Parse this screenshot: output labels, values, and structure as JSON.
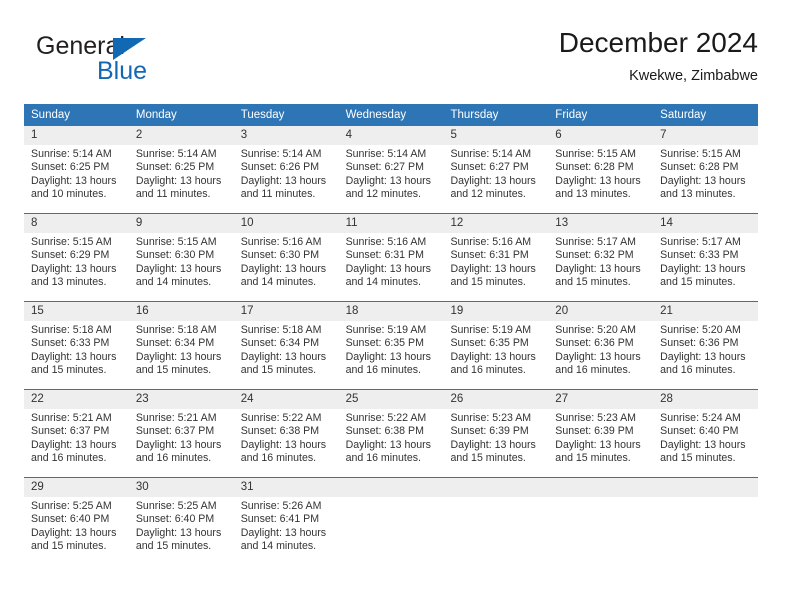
{
  "brand": {
    "name_part1": "General",
    "name_part2": "Blue",
    "logo_icon": "triangle-flag-icon",
    "color_primary": "#1268b3",
    "color_text": "#231f20"
  },
  "header": {
    "title": "December 2024",
    "subtitle": "Kwekwe, Zimbabwe"
  },
  "calendar": {
    "header_bg": "#2e75b6",
    "header_text_color": "#ffffff",
    "day_band_bg": "#eeeeee",
    "weekdays": [
      "Sunday",
      "Monday",
      "Tuesday",
      "Wednesday",
      "Thursday",
      "Friday",
      "Saturday"
    ],
    "weeks": [
      [
        {
          "day": "1",
          "sunrise": "Sunrise: 5:14 AM",
          "sunset": "Sunset: 6:25 PM",
          "daylight_line1": "Daylight: 13 hours",
          "daylight_line2": "and 10 minutes."
        },
        {
          "day": "2",
          "sunrise": "Sunrise: 5:14 AM",
          "sunset": "Sunset: 6:25 PM",
          "daylight_line1": "Daylight: 13 hours",
          "daylight_line2": "and 11 minutes."
        },
        {
          "day": "3",
          "sunrise": "Sunrise: 5:14 AM",
          "sunset": "Sunset: 6:26 PM",
          "daylight_line1": "Daylight: 13 hours",
          "daylight_line2": "and 11 minutes."
        },
        {
          "day": "4",
          "sunrise": "Sunrise: 5:14 AM",
          "sunset": "Sunset: 6:27 PM",
          "daylight_line1": "Daylight: 13 hours",
          "daylight_line2": "and 12 minutes."
        },
        {
          "day": "5",
          "sunrise": "Sunrise: 5:14 AM",
          "sunset": "Sunset: 6:27 PM",
          "daylight_line1": "Daylight: 13 hours",
          "daylight_line2": "and 12 minutes."
        },
        {
          "day": "6",
          "sunrise": "Sunrise: 5:15 AM",
          "sunset": "Sunset: 6:28 PM",
          "daylight_line1": "Daylight: 13 hours",
          "daylight_line2": "and 13 minutes."
        },
        {
          "day": "7",
          "sunrise": "Sunrise: 5:15 AM",
          "sunset": "Sunset: 6:28 PM",
          "daylight_line1": "Daylight: 13 hours",
          "daylight_line2": "and 13 minutes."
        }
      ],
      [
        {
          "day": "8",
          "sunrise": "Sunrise: 5:15 AM",
          "sunset": "Sunset: 6:29 PM",
          "daylight_line1": "Daylight: 13 hours",
          "daylight_line2": "and 13 minutes."
        },
        {
          "day": "9",
          "sunrise": "Sunrise: 5:15 AM",
          "sunset": "Sunset: 6:30 PM",
          "daylight_line1": "Daylight: 13 hours",
          "daylight_line2": "and 14 minutes."
        },
        {
          "day": "10",
          "sunrise": "Sunrise: 5:16 AM",
          "sunset": "Sunset: 6:30 PM",
          "daylight_line1": "Daylight: 13 hours",
          "daylight_line2": "and 14 minutes."
        },
        {
          "day": "11",
          "sunrise": "Sunrise: 5:16 AM",
          "sunset": "Sunset: 6:31 PM",
          "daylight_line1": "Daylight: 13 hours",
          "daylight_line2": "and 14 minutes."
        },
        {
          "day": "12",
          "sunrise": "Sunrise: 5:16 AM",
          "sunset": "Sunset: 6:31 PM",
          "daylight_line1": "Daylight: 13 hours",
          "daylight_line2": "and 15 minutes."
        },
        {
          "day": "13",
          "sunrise": "Sunrise: 5:17 AM",
          "sunset": "Sunset: 6:32 PM",
          "daylight_line1": "Daylight: 13 hours",
          "daylight_line2": "and 15 minutes."
        },
        {
          "day": "14",
          "sunrise": "Sunrise: 5:17 AM",
          "sunset": "Sunset: 6:33 PM",
          "daylight_line1": "Daylight: 13 hours",
          "daylight_line2": "and 15 minutes."
        }
      ],
      [
        {
          "day": "15",
          "sunrise": "Sunrise: 5:18 AM",
          "sunset": "Sunset: 6:33 PM",
          "daylight_line1": "Daylight: 13 hours",
          "daylight_line2": "and 15 minutes."
        },
        {
          "day": "16",
          "sunrise": "Sunrise: 5:18 AM",
          "sunset": "Sunset: 6:34 PM",
          "daylight_line1": "Daylight: 13 hours",
          "daylight_line2": "and 15 minutes."
        },
        {
          "day": "17",
          "sunrise": "Sunrise: 5:18 AM",
          "sunset": "Sunset: 6:34 PM",
          "daylight_line1": "Daylight: 13 hours",
          "daylight_line2": "and 15 minutes."
        },
        {
          "day": "18",
          "sunrise": "Sunrise: 5:19 AM",
          "sunset": "Sunset: 6:35 PM",
          "daylight_line1": "Daylight: 13 hours",
          "daylight_line2": "and 16 minutes."
        },
        {
          "day": "19",
          "sunrise": "Sunrise: 5:19 AM",
          "sunset": "Sunset: 6:35 PM",
          "daylight_line1": "Daylight: 13 hours",
          "daylight_line2": "and 16 minutes."
        },
        {
          "day": "20",
          "sunrise": "Sunrise: 5:20 AM",
          "sunset": "Sunset: 6:36 PM",
          "daylight_line1": "Daylight: 13 hours",
          "daylight_line2": "and 16 minutes."
        },
        {
          "day": "21",
          "sunrise": "Sunrise: 5:20 AM",
          "sunset": "Sunset: 6:36 PM",
          "daylight_line1": "Daylight: 13 hours",
          "daylight_line2": "and 16 minutes."
        }
      ],
      [
        {
          "day": "22",
          "sunrise": "Sunrise: 5:21 AM",
          "sunset": "Sunset: 6:37 PM",
          "daylight_line1": "Daylight: 13 hours",
          "daylight_line2": "and 16 minutes."
        },
        {
          "day": "23",
          "sunrise": "Sunrise: 5:21 AM",
          "sunset": "Sunset: 6:37 PM",
          "daylight_line1": "Daylight: 13 hours",
          "daylight_line2": "and 16 minutes."
        },
        {
          "day": "24",
          "sunrise": "Sunrise: 5:22 AM",
          "sunset": "Sunset: 6:38 PM",
          "daylight_line1": "Daylight: 13 hours",
          "daylight_line2": "and 16 minutes."
        },
        {
          "day": "25",
          "sunrise": "Sunrise: 5:22 AM",
          "sunset": "Sunset: 6:38 PM",
          "daylight_line1": "Daylight: 13 hours",
          "daylight_line2": "and 16 minutes."
        },
        {
          "day": "26",
          "sunrise": "Sunrise: 5:23 AM",
          "sunset": "Sunset: 6:39 PM",
          "daylight_line1": "Daylight: 13 hours",
          "daylight_line2": "and 15 minutes."
        },
        {
          "day": "27",
          "sunrise": "Sunrise: 5:23 AM",
          "sunset": "Sunset: 6:39 PM",
          "daylight_line1": "Daylight: 13 hours",
          "daylight_line2": "and 15 minutes."
        },
        {
          "day": "28",
          "sunrise": "Sunrise: 5:24 AM",
          "sunset": "Sunset: 6:40 PM",
          "daylight_line1": "Daylight: 13 hours",
          "daylight_line2": "and 15 minutes."
        }
      ],
      [
        {
          "day": "29",
          "sunrise": "Sunrise: 5:25 AM",
          "sunset": "Sunset: 6:40 PM",
          "daylight_line1": "Daylight: 13 hours",
          "daylight_line2": "and 15 minutes."
        },
        {
          "day": "30",
          "sunrise": "Sunrise: 5:25 AM",
          "sunset": "Sunset: 6:40 PM",
          "daylight_line1": "Daylight: 13 hours",
          "daylight_line2": "and 15 minutes."
        },
        {
          "day": "31",
          "sunrise": "Sunrise: 5:26 AM",
          "sunset": "Sunset: 6:41 PM",
          "daylight_line1": "Daylight: 13 hours",
          "daylight_line2": "and 14 minutes."
        },
        {
          "day": "",
          "sunrise": "",
          "sunset": "",
          "daylight_line1": "",
          "daylight_line2": ""
        },
        {
          "day": "",
          "sunrise": "",
          "sunset": "",
          "daylight_line1": "",
          "daylight_line2": ""
        },
        {
          "day": "",
          "sunrise": "",
          "sunset": "",
          "daylight_line1": "",
          "daylight_line2": ""
        },
        {
          "day": "",
          "sunrise": "",
          "sunset": "",
          "daylight_line1": "",
          "daylight_line2": ""
        }
      ]
    ]
  }
}
